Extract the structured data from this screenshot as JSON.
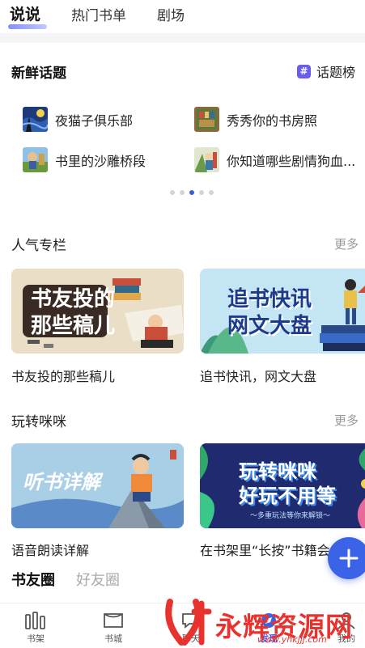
{
  "top_tabs": [
    "说说",
    "热门书单",
    "剧场"
  ],
  "fresh_topics": {
    "title": "新鲜话题",
    "rank_icon": "#",
    "rank_label": "话题榜",
    "items": [
      "夜猫子俱乐部",
      "秀秀你的书房照",
      "书里的沙雕桥段",
      "你知道哪些剧情狗血..."
    ],
    "pager_dots": 5,
    "active_dot": 2
  },
  "popular_columns": {
    "title": "人气专栏",
    "more": "更多",
    "cards": [
      {
        "art_text": [
          "书友投的",
          "那些稿儿"
        ],
        "caption": "书友投的那些稿儿"
      },
      {
        "art_text": [
          "追书快讯",
          "网文大盘"
        ],
        "caption": "追书快讯，网文大盘"
      }
    ]
  },
  "play_mimi": {
    "title": "玩转咪咪",
    "more": "更多",
    "cards": [
      {
        "art_text": [
          "听书详解"
        ],
        "caption": "语音朗读详解"
      },
      {
        "art_text": [
          "玩转咪咪",
          "好玩不用等"
        ],
        "art_sub": "～多重玩法等你来解锁～",
        "caption": "在书架里“长按”书籍会..."
      }
    ]
  },
  "circle_tabs": [
    "书友圈",
    "好友圈"
  ],
  "fab_icon": "plus-icon",
  "bottom_nav": [
    {
      "label": "书架",
      "icon": "bars-icon"
    },
    {
      "label": "书城",
      "icon": "book-icon"
    },
    {
      "label": "聊天",
      "icon": "chat-icon"
    },
    {
      "label": "发现",
      "icon": "discover-icon",
      "active": true
    },
    {
      "label": "我的",
      "icon": "user-icon"
    }
  ],
  "watermark": {
    "text": "永辉资源网",
    "url": "www.yhkjjj.com"
  },
  "colors": {
    "accent": "#3b63e8",
    "topic_badge": "#6a5cf0",
    "watermark": "#e8322e"
  }
}
